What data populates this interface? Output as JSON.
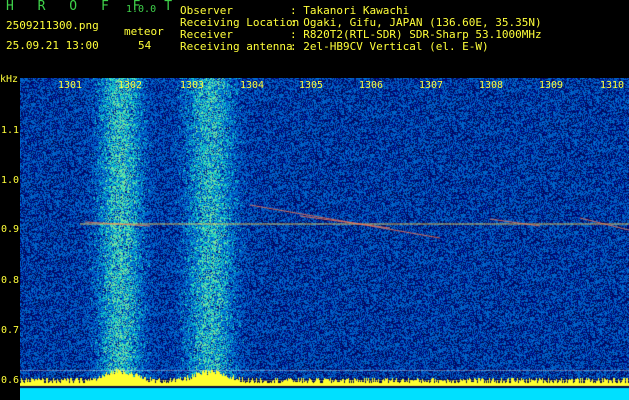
{
  "app": {
    "logo": "H R O F F T",
    "version": "1.0.0"
  },
  "file": {
    "name": "2509211300.png",
    "datetime": "25.09.21 13:00"
  },
  "meteor": {
    "label": "meteor",
    "count": "54"
  },
  "info": [
    {
      "label": "Observer",
      "value": ": Takanori Kawachi"
    },
    {
      "label": "Receiving Location",
      "value": ": Ogaki, Gifu, JAPAN (136.60E, 35.35N)"
    },
    {
      "label": "Receiver",
      "value": ": R820T2(RTL-SDR) SDR-Sharp 53.1000MHz"
    },
    {
      "label": "Receiving antenna",
      "value": ": 2el-HB9CV Vertical (el. E-W)"
    }
  ],
  "axis": {
    "unit": "kHz",
    "x_ticks": [
      "1301",
      "1302",
      "1303",
      "1304",
      "1305",
      "1306",
      "1307",
      "1308",
      "1309",
      "1310"
    ],
    "y_ticks": [
      "1.1",
      "1.0",
      "0.9",
      "0.8",
      "0.7",
      "0.6"
    ]
  },
  "colors": {
    "header_text": "#4bd54b",
    "value_text": "#ffff3a",
    "background": "#000000",
    "noise_base": "#0a1a8a"
  }
}
